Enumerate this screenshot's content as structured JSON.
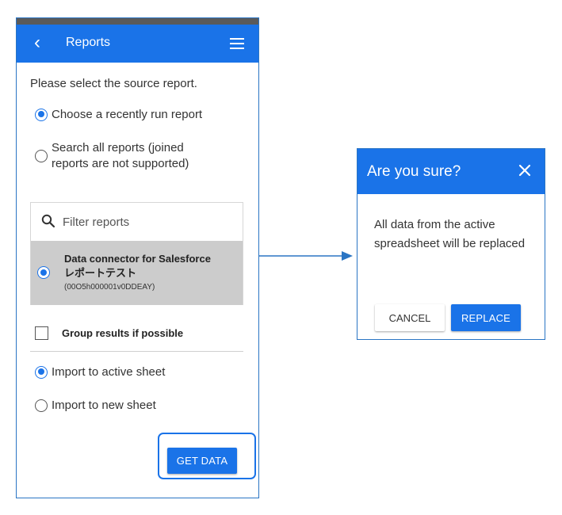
{
  "header": {
    "title": "Reports"
  },
  "prompt": "Please select the source report.",
  "source_options": [
    {
      "label": "Choose a recently run report",
      "checked": true
    },
    {
      "label_line1": "Search all reports (joined",
      "label_line2": "reports are not supported)",
      "checked": false
    }
  ],
  "filter": {
    "placeholder": "Filter reports"
  },
  "report": {
    "title": "Data connector for Salesforce",
    "subtitle": "レポートテスト",
    "id": "(00O5h000001v0DDEAY)",
    "selected": true
  },
  "group_results": {
    "label": "Group results if possible",
    "checked": false
  },
  "import_options": [
    {
      "label": "Import to active sheet",
      "checked": true
    },
    {
      "label": "Import to new sheet",
      "checked": false
    }
  ],
  "get_data_label": "GET DATA",
  "dialog": {
    "title": "Are you sure?",
    "body": "All data from the active spreadsheet will be replaced",
    "cancel_label": "CANCEL",
    "replace_label": "REPLACE"
  },
  "colors": {
    "accent": "#1a73e8",
    "border": "#2a75c4",
    "selected_row": "#cccccc"
  },
  "icons": [
    "back-icon",
    "menu-icon",
    "search-icon",
    "close-icon",
    "arrow-icon"
  ]
}
